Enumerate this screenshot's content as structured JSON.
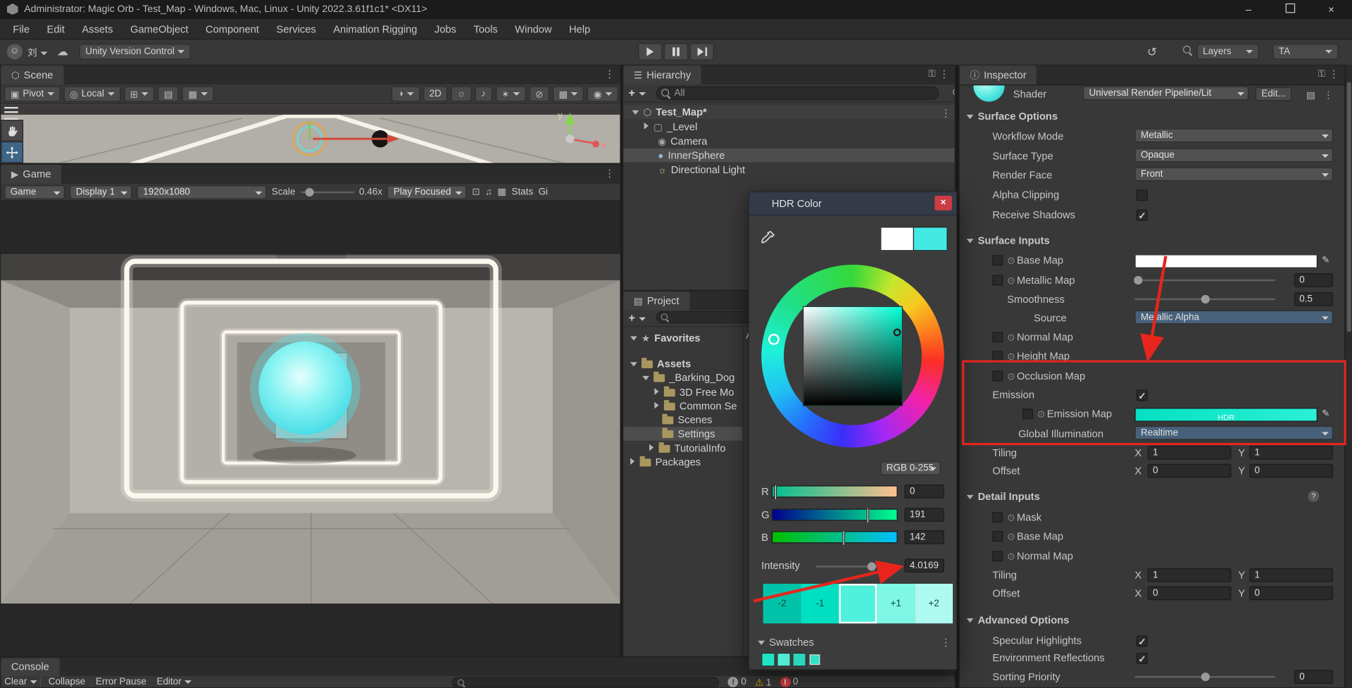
{
  "window": {
    "title": "Administrator: Magic Orb - Test_Map - Windows, Mac, Linux - Unity 2022.3.61f1c1* <DX11>"
  },
  "menu": {
    "items": [
      "File",
      "Edit",
      "Assets",
      "GameObject",
      "Component",
      "Services",
      "Animation Rigging",
      "Jobs",
      "Tools",
      "Window",
      "Help"
    ]
  },
  "toolbar": {
    "account_name": "刘",
    "version_control": "Unity Version Control",
    "layers": "Layers",
    "account_short": "TA"
  },
  "scene_panel": {
    "tab": "Scene",
    "pivot": "Pivot",
    "local": "Local",
    "mode_2d": "2D",
    "axis_x": "x",
    "axis_y": "y"
  },
  "game_panel": {
    "tab": "Game",
    "game_dropdown": "Game",
    "display": "Display 1",
    "resolution": "1920x1080",
    "scale_label": "Scale",
    "scale_value": "0.46x",
    "play_focused": "Play Focused",
    "stats": "Stats",
    "gizmos": "Gi"
  },
  "hierarchy_panel": {
    "tab": "Hierarchy",
    "search_value": "All",
    "items": [
      {
        "label": "Test_Map*",
        "selected": false
      },
      {
        "label": "_Level",
        "selected": false
      },
      {
        "label": "Camera",
        "selected": false
      },
      {
        "label": "InnerSphere",
        "selected": true
      },
      {
        "label": "Directional Light",
        "selected": false
      }
    ]
  },
  "project_panel": {
    "tab": "Project",
    "favorites": "Favorites",
    "right_pane_header": "As",
    "items": [
      {
        "label": "Assets",
        "selected": false
      },
      {
        "label": "_Barking_Dog",
        "selected": false
      },
      {
        "label": "3D Free Mo",
        "selected": false
      },
      {
        "label": "Common Se",
        "selected": false
      },
      {
        "label": "Scenes",
        "selected": false
      },
      {
        "label": "Settings",
        "selected": true
      },
      {
        "label": "TutorialInfo",
        "selected": false
      },
      {
        "label": "Packages",
        "selected": false
      }
    ]
  },
  "hdr_dialog": {
    "title": "HDR Color",
    "mode": "RGB 0-255",
    "channels": [
      {
        "label": "R",
        "value": "0"
      },
      {
        "label": "G",
        "value": "191"
      },
      {
        "label": "B",
        "value": "142"
      }
    ],
    "intensity_label": "Intensity",
    "intensity_value": "4.0169",
    "exposure_labels": [
      "-2",
      "-1",
      "+1",
      "+2"
    ],
    "swatches_label": "Swatches",
    "current_color": "#45e9e3",
    "swatch_colors": [
      "#1fe3c3",
      "#52ead2",
      "#2cd6bd",
      "#2fe0c6"
    ]
  },
  "inspector": {
    "tab": "Inspector",
    "shader": {
      "label": "Shader",
      "value": "Universal Render Pipeline/Lit",
      "edit": "Edit..."
    },
    "surface_options": {
      "title": "Surface Options",
      "workflow_mode": {
        "label": "Workflow Mode",
        "value": "Metallic"
      },
      "surface_type": {
        "label": "Surface Type",
        "value": "Opaque"
      },
      "render_face": {
        "label": "Render Face",
        "value": "Front"
      },
      "alpha_clipping": {
        "label": "Alpha Clipping",
        "checked": false
      },
      "receive_shadows": {
        "label": "Receive Shadows",
        "checked": true
      }
    },
    "surface_inputs": {
      "title": "Surface Inputs",
      "base_map": {
        "label": "Base Map"
      },
      "metallic_map": {
        "label": "Metallic Map",
        "value": "0"
      },
      "smoothness": {
        "label": "Smoothness",
        "value": "0.5"
      },
      "source": {
        "label": "Source",
        "value": "Metallic Alpha"
      },
      "normal_map": {
        "label": "Normal Map"
      },
      "height_map": {
        "label": "Height Map"
      },
      "occlusion_map": {
        "label": "Occlusion Map"
      },
      "emission": {
        "label": "Emission",
        "checked": true
      },
      "emission_map": {
        "label": "Emission Map",
        "hdr_badge": "HDR"
      },
      "global_illumination": {
        "label": "Global Illumination",
        "value": "Realtime"
      },
      "tiling": {
        "label": "Tiling",
        "x_label": "X",
        "x": "1",
        "y_label": "Y",
        "y": "1"
      },
      "offset": {
        "label": "Offset",
        "x_label": "X",
        "x": "0",
        "y_label": "Y",
        "y": "0"
      }
    },
    "detail_inputs": {
      "title": "Detail Inputs",
      "mask": {
        "label": "Mask"
      },
      "base_map": {
        "label": "Base Map"
      },
      "normal_map": {
        "label": "Normal Map"
      },
      "tiling": {
        "label": "Tiling",
        "x_label": "X",
        "x": "1",
        "y_label": "Y",
        "y": "1"
      },
      "offset": {
        "label": "Offset",
        "x_label": "X",
        "x": "0",
        "y_label": "Y",
        "y": "0"
      }
    },
    "advanced_options": {
      "title": "Advanced Options",
      "specular_highlights": {
        "label": "Specular Highlights",
        "checked": true
      },
      "environment_reflections": {
        "label": "Environment Reflections",
        "checked": true
      },
      "sorting_priority": {
        "label": "Sorting Priority",
        "value": "0"
      }
    }
  },
  "console": {
    "tab": "Console",
    "clear": "Clear",
    "collapse": "Collapse",
    "error_pause": "Error Pause",
    "editor": "Editor",
    "info_count": "0",
    "warning_count": "1",
    "error_count": "0"
  },
  "annotations": {
    "color": "#e8251d"
  }
}
